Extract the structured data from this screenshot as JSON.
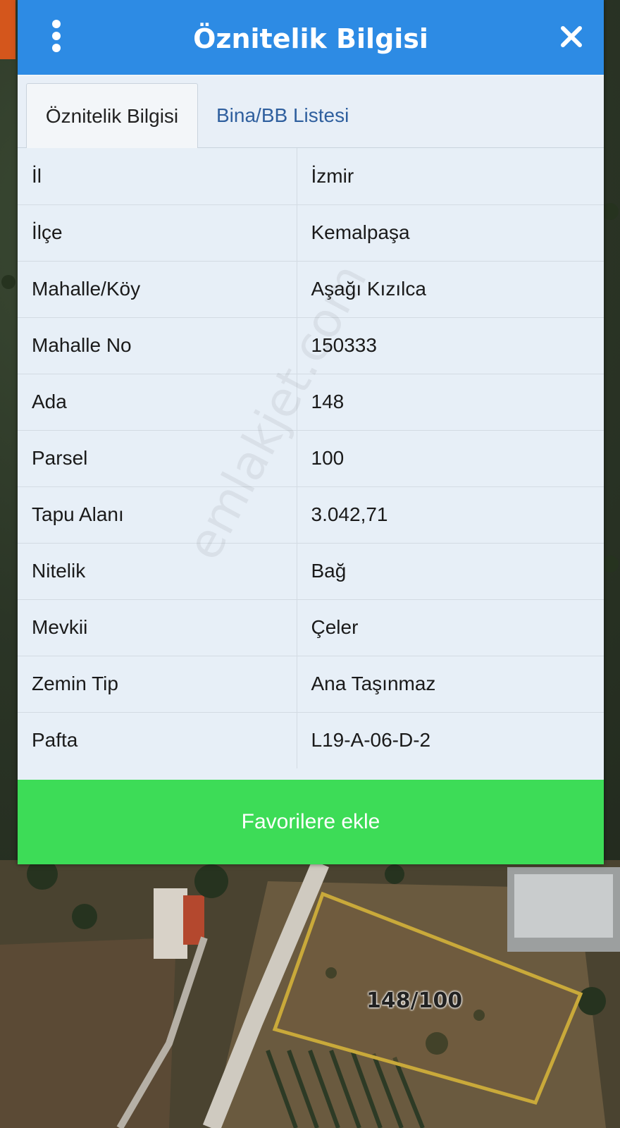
{
  "dialog": {
    "title": "Öznitelik Bilgisi",
    "menu_icon": "kebab-menu-icon",
    "close_icon": "close-icon"
  },
  "tabs": [
    {
      "label": "Öznitelik Bilgisi",
      "active": true
    },
    {
      "label": "Bina/BB Listesi",
      "active": false
    }
  ],
  "attributes": [
    {
      "key": "İl",
      "value": "İzmir"
    },
    {
      "key": "İlçe",
      "value": "Kemalpaşa"
    },
    {
      "key": "Mahalle/Köy",
      "value": "Aşağı Kızılca"
    },
    {
      "key": "Mahalle No",
      "value": "150333"
    },
    {
      "key": "Ada",
      "value": "148"
    },
    {
      "key": "Parsel",
      "value": "100"
    },
    {
      "key": "Tapu Alanı",
      "value": "3.042,71"
    },
    {
      "key": "Nitelik",
      "value": "Bağ"
    },
    {
      "key": "Mevkii",
      "value": "Çeler"
    },
    {
      "key": "Zemin Tip",
      "value": "Ana Taşınmaz"
    },
    {
      "key": "Pafta",
      "value": "L19-A-06-D-2"
    }
  ],
  "favorite_button": {
    "label": "Favorilere ekle"
  },
  "map": {
    "parcel_label": "148/100"
  },
  "watermark": "emlakjet.com",
  "colors": {
    "header": "#2d8be4",
    "favorite_button": "#3ddc57",
    "parcel_outline": "#c9a93a",
    "inactive_tab_text": "#2f5f9e"
  }
}
